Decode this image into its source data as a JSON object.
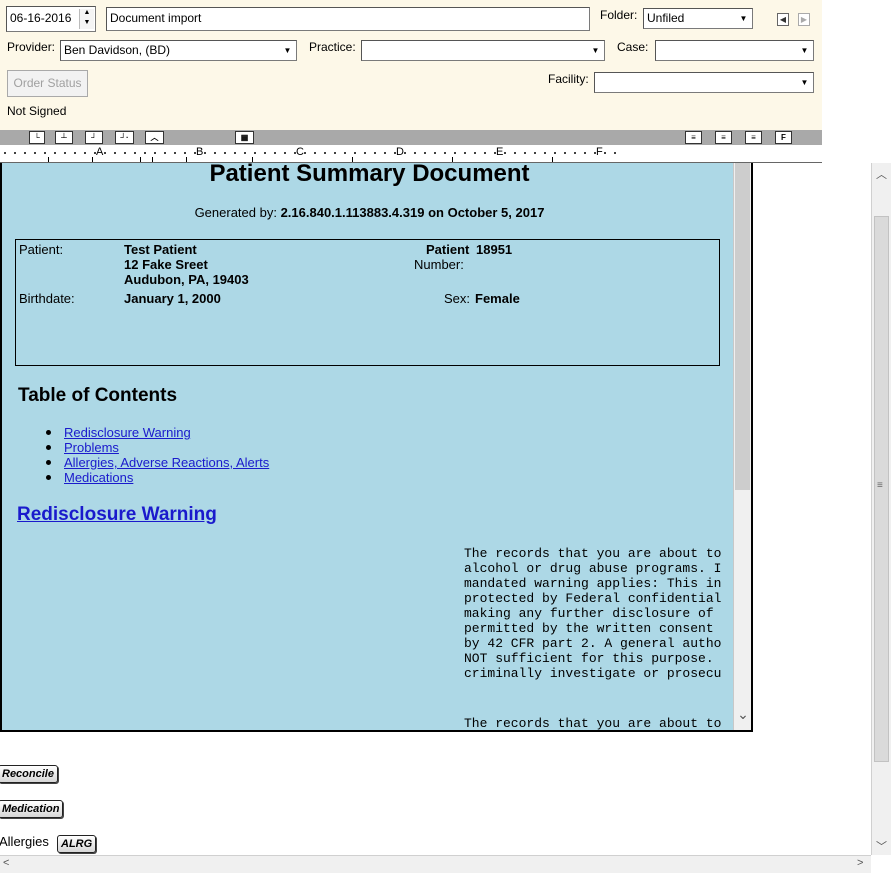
{
  "header": {
    "date_value": "06-16-2016",
    "description_value": "Document import",
    "folder_label": "Folder:",
    "folder_value": "Unfiled",
    "provider_label": "Provider:",
    "provider_value": "Ben Davidson, (BD)",
    "practice_label": "Practice:",
    "practice_value": "",
    "case_label": "Case:",
    "case_value": "",
    "order_status_label": "Order Status",
    "facility_label": "Facility:",
    "facility_value": "",
    "sign_status": "Not Signed"
  },
  "ruler": {
    "letters": [
      "A",
      "B",
      "C",
      "D",
      "E",
      "F"
    ]
  },
  "document": {
    "title": "Patient Summary Document",
    "generated_prefix": "Generated by:",
    "generated_by": "2.16.840.1.113883.4.319",
    "generated_on_word": "on",
    "generated_date": "October 5, 2017",
    "patient_label": "Patient:",
    "patient_name": "Test Patient",
    "patient_addr1": "12 Fake Sreet",
    "patient_addr2": "Audubon, PA, 19403",
    "patient_number_label_1": "Patient",
    "patient_number_label_2": "Number:",
    "patient_number": "18951",
    "birthdate_label": "Birthdate:",
    "birthdate_value": "January 1, 2000",
    "sex_label": "Sex:",
    "sex_value": "Female",
    "toc_heading": "Table of Contents",
    "toc_items": [
      "Redisclosure Warning",
      "Problems",
      "Allergies, Adverse Reactions, Alerts",
      "Medications"
    ],
    "section_heading": "Redisclosure Warning",
    "warning_lines": [
      "The records that you are about to",
      "alcohol or drug abuse programs. I",
      "mandated warning applies: This in",
      "protected by Federal confidential",
      "making any further disclosure of",
      "permitted by the written consent",
      "by 42 CFR part 2. A general autho",
      "NOT sufficient for this purpose.",
      "criminally investigate or prosecu"
    ],
    "warning_line_2": "The records that you are about to"
  },
  "buttons": {
    "reconcile": "Reconcile",
    "medication": "Medication",
    "allergies_label": "Allergies",
    "alrg": "ALRG"
  }
}
